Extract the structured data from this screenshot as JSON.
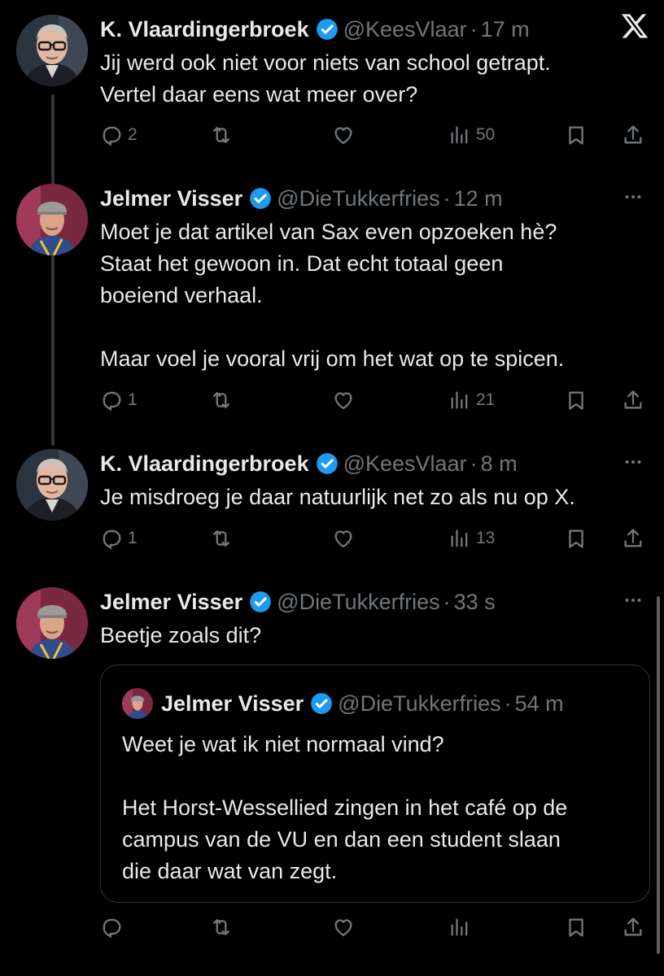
{
  "tweets": [
    {
      "name": "K. Vlaardingerbroek",
      "handle": "@KeesVlaar",
      "time": "17 m",
      "text": "Jij werd ook niet voor niets van school getrapt.\nVertel daar eens wat meer over?",
      "reply_count": "2",
      "views": "50"
    },
    {
      "name": "Jelmer Visser",
      "handle": "@DieTukkerfries",
      "time": "12 m",
      "text": "Moet je dat artikel van Sax even opzoeken hè?\nStaat het gewoon in. Dat echt totaal geen\nboeiend verhaal.\n\nMaar voel je vooral vrij om het wat op te spicen.",
      "reply_count": "1",
      "views": "21"
    },
    {
      "name": "K. Vlaardingerbroek",
      "handle": "@KeesVlaar",
      "time": "8 m",
      "text": "Je misdroeg je daar natuurlijk net zo als nu op X.",
      "reply_count": "1",
      "views": "13"
    },
    {
      "name": "Jelmer Visser",
      "handle": "@DieTukkerfries",
      "time": "33 s",
      "text": "Beetje zoals dit?",
      "reply_count": "",
      "views": ""
    }
  ],
  "quote": {
    "name": "Jelmer Visser",
    "handle": "@DieTukkerfries",
    "time": "54 m",
    "text": "Weet je wat ik niet normaal vind?\n\nHet Horst-Wessellied zingen in het café op de\ncampus van de VU en dan een student slaan\ndie daar wat van zegt."
  },
  "separator": "·",
  "colors": {
    "background": "#000000",
    "text": "#e7e9ea",
    "muted": "#71767b",
    "verified": "#1d9bf0",
    "thread_line": "#333639",
    "quote_border": "#2f3336"
  },
  "icons": [
    "x-logo-icon",
    "verified-badge-icon",
    "more-icon",
    "reply-icon",
    "retweet-icon",
    "like-icon",
    "views-icon",
    "bookmark-icon",
    "share-icon"
  ]
}
